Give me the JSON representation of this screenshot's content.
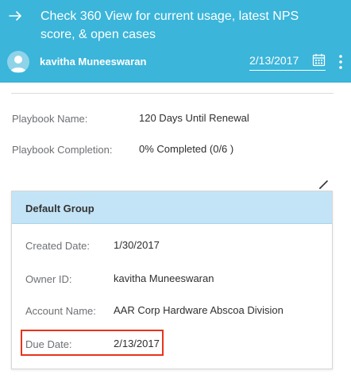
{
  "header": {
    "title": "Check 360 View for current usage, latest NPS score, & open cases",
    "owner_name": "kavitha Muneeswaran",
    "due_date": "2/13/2017",
    "icons": {
      "back": "arrow-right-icon",
      "calendar": "calendar-icon",
      "more": "more-vertical-icon"
    },
    "colors": {
      "header_bg": "#3bb5da",
      "group_header_bg": "#c3e4f6",
      "highlight": "#e8331d"
    }
  },
  "playbook": {
    "name_label": "Playbook Name:",
    "name_value": "120 Days Until Renewal",
    "completion_label": "Playbook Completion:",
    "completion_value": "0% Completed (0/6 )"
  },
  "group": {
    "title": "Default Group",
    "fields": [
      {
        "label": "Created Date:",
        "value": "1/30/2017"
      },
      {
        "label": "Owner ID:",
        "value": "kavitha Muneeswaran"
      },
      {
        "label": "Account Name:",
        "value": "AAR Corp Hardware Abscoa Division"
      },
      {
        "label": "Due Date:",
        "value": "2/13/2017"
      }
    ]
  }
}
